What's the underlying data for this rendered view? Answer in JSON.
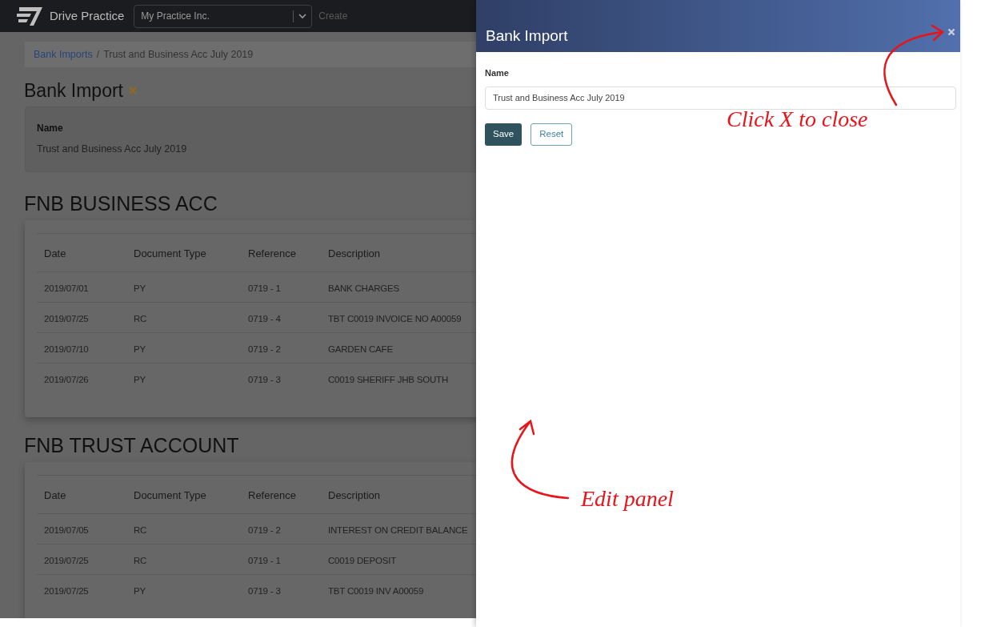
{
  "navbar": {
    "brand": "Drive Practice",
    "practice_select": "My Practice Inc.",
    "create_link": "Create"
  },
  "breadcrumb_separator": "/",
  "breadcrumb": [
    {
      "label": "Bank Imports",
      "kind": "link"
    },
    {
      "label": "Trust and Business Acc July 2019",
      "kind": "current"
    }
  ],
  "page_title": "Bank Import",
  "details": {
    "label": "Name",
    "value": "Trust and Business Acc July 2019"
  },
  "accounts": [
    {
      "title": "FNB BUSINESS ACC",
      "columns": [
        "Date",
        "Document Type",
        "Reference",
        "Description"
      ],
      "rows": [
        [
          "2019/07/01",
          "PY",
          "0719 - 1",
          "BANK CHARGES"
        ],
        [
          "2019/07/25",
          "RC",
          "0719 - 4",
          "TBT C0019 INVOICE NO A00059"
        ],
        [
          "2019/07/10",
          "PY",
          "0719 - 2",
          "GARDEN CAFE"
        ],
        [
          "2019/07/26",
          "PY",
          "0719 - 3",
          "C0019 SHERIFF JHB SOUTH"
        ]
      ]
    },
    {
      "title": "FNB TRUST ACCOUNT",
      "columns": [
        "Date",
        "Document Type",
        "Reference",
        "Description"
      ],
      "rows": [
        [
          "2019/07/05",
          "RC",
          "0719 - 2",
          "INTEREST ON CREDIT BALANCE"
        ],
        [
          "2019/07/25",
          "RC",
          "0719 - 1",
          "C0019 DEPOSIT"
        ],
        [
          "2019/07/25",
          "PY",
          "0719 - 3",
          "TBT C0019 INV A00059"
        ]
      ]
    }
  ],
  "edit_panel": {
    "title": "Bank Import",
    "field_label": "Name",
    "field_value": "Trust and Business Acc July 2019",
    "buttons": [
      {
        "label": "Save",
        "kind": "primary"
      },
      {
        "label": "Reset",
        "kind": "secondary"
      }
    ]
  },
  "annotations": [
    {
      "text": "Click X to close",
      "kind": "close-hint"
    },
    {
      "text": "Edit panel",
      "kind": "panel-hint"
    }
  ]
}
